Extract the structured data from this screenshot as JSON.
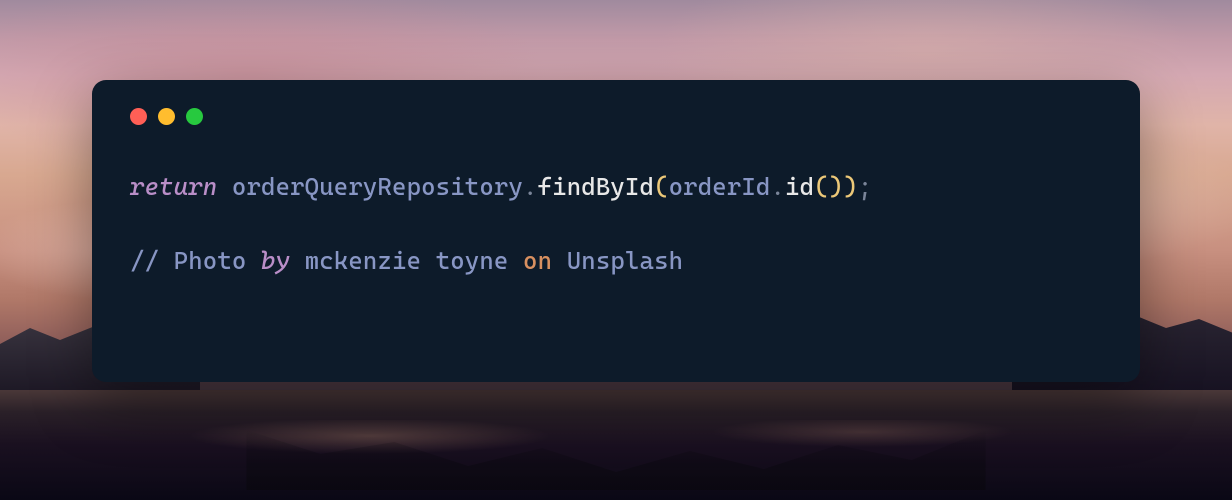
{
  "code": {
    "line1": {
      "keyword": "return",
      "space1": " ",
      "obj1": "orderQueryRepository",
      "dot1": ".",
      "method1": "findById",
      "paren1": "(",
      "obj2": "orderId",
      "dot2": ".",
      "method2": "id",
      "paren2": "(",
      "paren3": ")",
      "paren4": ")",
      "semi": ";"
    },
    "line2": {
      "comment_start": "// ",
      "word1": "Photo ",
      "word2_italic": "by",
      "space1": " ",
      "word3": "mckenzie toyne ",
      "word4_orange": "on",
      "space2": " ",
      "word5": "Unsplash"
    }
  },
  "colors": {
    "window_bg": "#0d1b2a",
    "close": "#ff5f56",
    "minimize": "#ffbd2e",
    "maximize": "#27c93f"
  }
}
